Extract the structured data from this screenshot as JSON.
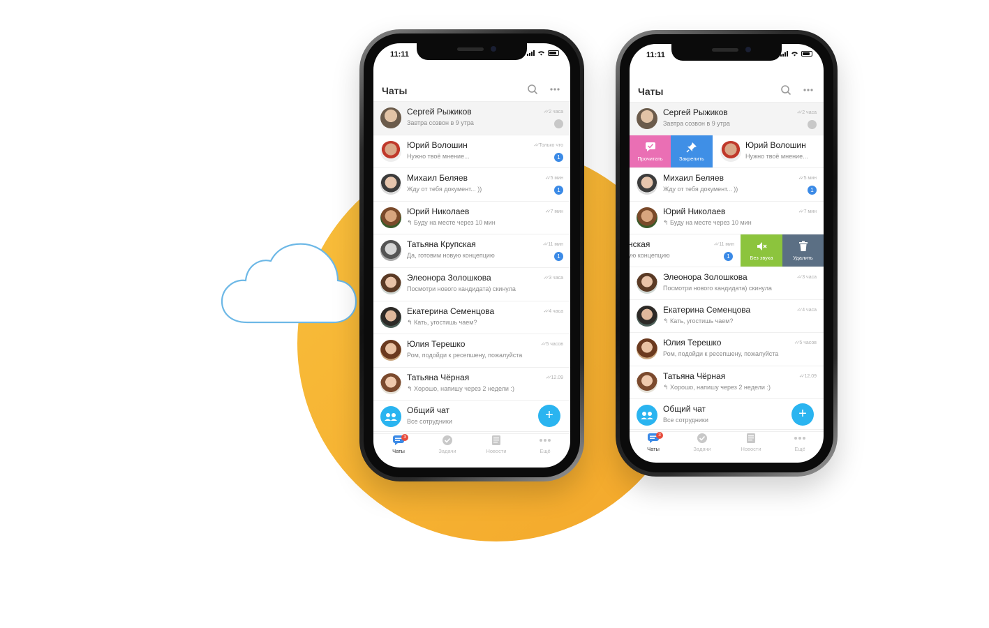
{
  "status": {
    "time": "11:11"
  },
  "header": {
    "title": "Чаты"
  },
  "phone1": {
    "chats": [
      {
        "name": "Сергей Рыжиков",
        "message": "Завтра созвон в 9 утра",
        "time": "2 часа",
        "pinned": true
      },
      {
        "name": "Юрий Волошин",
        "message": "Нужно твоё мнение...",
        "time": "Только что",
        "unread": "1"
      },
      {
        "name": "Михаил Беляев",
        "message": "Жду от тебя документ... ))",
        "time": "5 мин",
        "unread": "1"
      },
      {
        "name": "Юрий Николаев",
        "message": "↰ Буду на месте через 10 мин",
        "time": "7 мин"
      },
      {
        "name": "Татьяна Крупская",
        "message": "Да, готовим новую концепцию",
        "time": "11 мин",
        "unread": "1"
      },
      {
        "name": "Элеонора Золошкова",
        "message": "Посмотри нового кандидата) скинула",
        "time": "3 часа"
      },
      {
        "name": "Екатерина Семенцова",
        "message": "↰ Кать, угостишь чаем?",
        "time": "4 часа"
      },
      {
        "name": "Юлия Терешко",
        "message": "Ром, подойди к ресепшену, пожалуйста",
        "time": "5 часов"
      },
      {
        "name": "Татьяна Чёрная",
        "message": "↰ Хорошо, напишу через 2 недели :)",
        "time": "12.09"
      },
      {
        "name": "Общий чат",
        "message": "Все сотрудники"
      }
    ]
  },
  "phone2": {
    "chats": [
      {
        "name": "Сергей Рыжиков",
        "message": "Завтра созвон в 9 утра",
        "time": "2 часа"
      },
      {
        "name": "Юрий Волошин",
        "message": "Нужно твоё мнение..."
      },
      {
        "name": "Михаил Беляев",
        "message": "Жду от тебя документ... ))",
        "time": "5 мин",
        "unread": "1"
      },
      {
        "name": "Юрий Николаев",
        "message": "↰ Буду на месте через 10 мин",
        "time": "7 мин"
      },
      {
        "name": "нская",
        "message": "ую концепцию",
        "time": "11 мин",
        "unread": "1"
      },
      {
        "name": "Элеонора Золошкова",
        "message": "Посмотри нового кандидата) скинула",
        "time": "3 часа"
      },
      {
        "name": "Екатерина Семенцова",
        "message": "↰ Кать, угостишь чаем?",
        "time": "4 часа"
      },
      {
        "name": "Юлия Терешко",
        "message": "Ром, подойди к ресепшену, пожалуйста",
        "time": "5 часов"
      },
      {
        "name": "Татьяна Чёрная",
        "message": "↰ Хорошо, напишу через 2 недели :)",
        "time": "12.09"
      },
      {
        "name": "Общий чат",
        "message": "Все сотрудники"
      }
    ],
    "left_actions": {
      "read": "Прочитать",
      "pin": "Закрепить"
    },
    "right_actions": {
      "mute": "Без звука",
      "delete": "Удалить"
    }
  },
  "tabs": {
    "chats": "Чаты",
    "chats_badge": "3",
    "tasks": "Задачи",
    "news": "Новости",
    "more": "Ещё"
  },
  "fab": {
    "label": "+"
  },
  "colors": {
    "accent": "#2ab4f0",
    "badge": "#3b8ae6",
    "read_action": "#ea6fb4",
    "pin_action": "#3f8fe6",
    "mute_action": "#8cc43d",
    "delete_action": "#5b6f84",
    "circle": "#f6b232"
  }
}
